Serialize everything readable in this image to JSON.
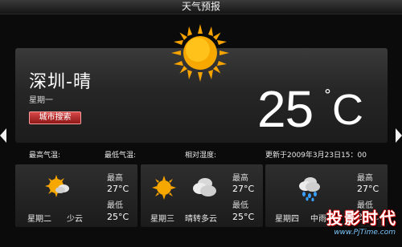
{
  "app": {
    "title": "天气预报"
  },
  "current": {
    "city": "深圳-晴",
    "weekday": "星期一",
    "city_search_button": "城市搜索",
    "temperature": "25",
    "unit_degree": "°",
    "unit_c": "C",
    "icon": "sun-icon"
  },
  "stats": {
    "high_label": "最高气温:",
    "low_label": "最低气温:",
    "humidity_label": "相对湿度:",
    "updated": "更新于2009年3月23日15：00"
  },
  "forecast": [
    {
      "day": "星期二",
      "condition": "少云",
      "high_label": "最高",
      "high": "27",
      "low_label": "最低",
      "low": "25",
      "unit": "°C",
      "icon": "partly-cloudy-icon"
    },
    {
      "day": "星期三",
      "condition": "晴转多云",
      "high_label": "最高",
      "high": "27",
      "low_label": "最低",
      "low": "25",
      "unit": "°C",
      "icon": "sun-cloud-icon"
    },
    {
      "day": "星期四",
      "condition": "中雨",
      "high_label": "最高",
      "high": "27",
      "low_label": "最低",
      "low": "25",
      "unit": "°C",
      "icon": "rain-icon"
    }
  ],
  "watermark": {
    "title": "投影时代",
    "url": "www.PjTime.com"
  },
  "colors": {
    "accent_red": "#b51f1f",
    "sun": "#f7a800",
    "background": "#0b0b0b"
  }
}
